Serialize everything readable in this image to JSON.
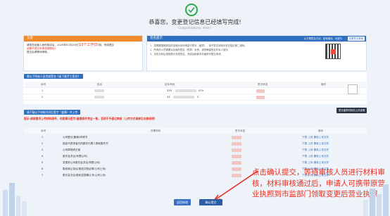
{
  "header": {
    "title": "恭喜您，变更登记信息已经填写完成!",
    "subtitle": "Congratulations, done !"
  },
  "notice": {
    "heading": "注意",
    "line1a": "请您在经营人身份核实后，",
    "deadline": "2025年01月10日",
    "limit": "(10个工作日)",
    "line1b": "前，完成提交",
    "line2": "逾期不提交申请将被删除!",
    "line3": "提交后请等待审核。"
  },
  "sign": {
    "heading": "签名提示",
    "link": "以下是签名方法，如有疑问，可进行",
    "button": "查看签名教程",
    "tips": [
      "1、您需要按照规范的流程对本申请进行签字（盖章），电子签名请用手机扫描右侧二维码。",
      "2、所有的人员需要对自身的签名（签章）负责，请您确保签名时本人操作。",
      "3、手机扫码后请按提示完成签名，完成后刷新本页面即可提交申请。"
    ]
  },
  "table1": {
    "button": "需以下所有人员完成签名《或下载手工签名》",
    "columns": [
      "序号",
      "姓名",
      "证件号码",
      "签字状态",
      "操作"
    ],
    "rows": [
      {
        "no": "1",
        "id_partial": "339",
        "id_tail": "079"
      },
      {
        "no": "2",
        "id_partial": "33",
        "id_tail": "5"
      }
    ]
  },
  "table2": {
    "button": "请下载以下材料打印后签字（盖章）并上传",
    "warning": "提示/请按要求上传材料原件，内容需与签字/盖章原件完全一致，否则不予通过审核（上传方式请参见右侧说明）",
    "right_button": "签字盖章材料的上传说明",
    "columns": [
      "序号",
      "所需材料",
      "签字状态",
      "操作"
    ],
    "rows": [
      {
        "no": "1",
        "name": "公司登记(备案)申请书",
        "ops": "下载  上传  删除上传文件"
      },
      {
        "no": "2",
        "name": "指定代表或者共同委托代理人授权委托书",
        "ops": "下载  上传  删除上传文件"
      },
      {
        "no": "3",
        "name": "公司章程修正案",
        "ops": "下载  上传  删除上传文件"
      },
      {
        "no": "4",
        "name": "股东会决议(有限公司)",
        "ops": "下载  上传  删除上传文件"
      },
      {
        "no": "5",
        "name": "变更前公司股东会决议(有限公司)",
        "ops": "下载  上传  删除上传文件"
      },
      {
        "no": "6",
        "name": "股权转让协议/股权交割证明(公司上传)",
        "ops": "下载  上传  删除上传文件"
      },
      {
        "no": "7",
        "name": "股东会决议/股权变更确认书(公司上传)",
        "ops": "下载  上传  删除上传文件"
      }
    ]
  },
  "overlay_text": "点击确认提交，等待审核人员进行材料审核，材料审核通过后，申请人可携带原营业执照到市监部门领取变更后营业执照",
  "footer": {
    "back_button": "返回修改",
    "confirm_button": "确认提交"
  },
  "colors": {
    "success": "#2ca84a",
    "primary": "#2f6fbf",
    "orange": "#f08a2b",
    "danger": "#e8301f"
  }
}
